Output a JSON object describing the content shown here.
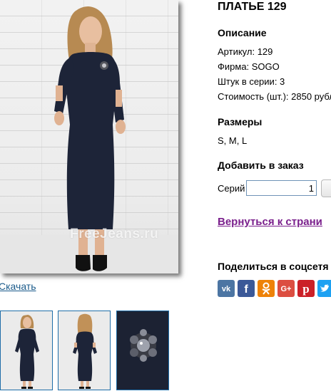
{
  "product": {
    "title": "ПЛАТЬЕ 129",
    "watermark": "FreeJeans.ru",
    "download_link": "Скачать"
  },
  "description": {
    "heading": "Описание",
    "article": "Артикул: 129",
    "brand": "Фирма: SOGO",
    "pieces": "Штук в серии: 3",
    "price": "Стоимость (шт.): 2850 рубл"
  },
  "sizes": {
    "heading": "Размеры",
    "values": "S, M, L"
  },
  "order": {
    "heading": "Добавить в заказ",
    "series_label": "Серий",
    "series_value": "1"
  },
  "navigation": {
    "back_link": "Вернуться к страни"
  },
  "share": {
    "heading": "Поделиться в соцсетя",
    "buttons": [
      {
        "icon": "vk-icon",
        "color": "#4c75a3"
      },
      {
        "icon": "facebook-icon",
        "color": "#3b5998"
      },
      {
        "icon": "odnoklassniki-icon",
        "color": "#ee8208"
      },
      {
        "icon": "google-plus-icon",
        "color": "#dc4e41"
      },
      {
        "icon": "pinterest-icon",
        "color": "#cb2027"
      },
      {
        "icon": "twitter-icon",
        "color": "#1da1f2"
      }
    ]
  },
  "thumbnails": [
    "front-view",
    "back-view",
    "brooch-detail"
  ],
  "colors": {
    "dress": "#1d2438",
    "link": "#1a5a8a",
    "visited_link": "#7a1f8c",
    "thumb_border": "#1f6ea8"
  }
}
